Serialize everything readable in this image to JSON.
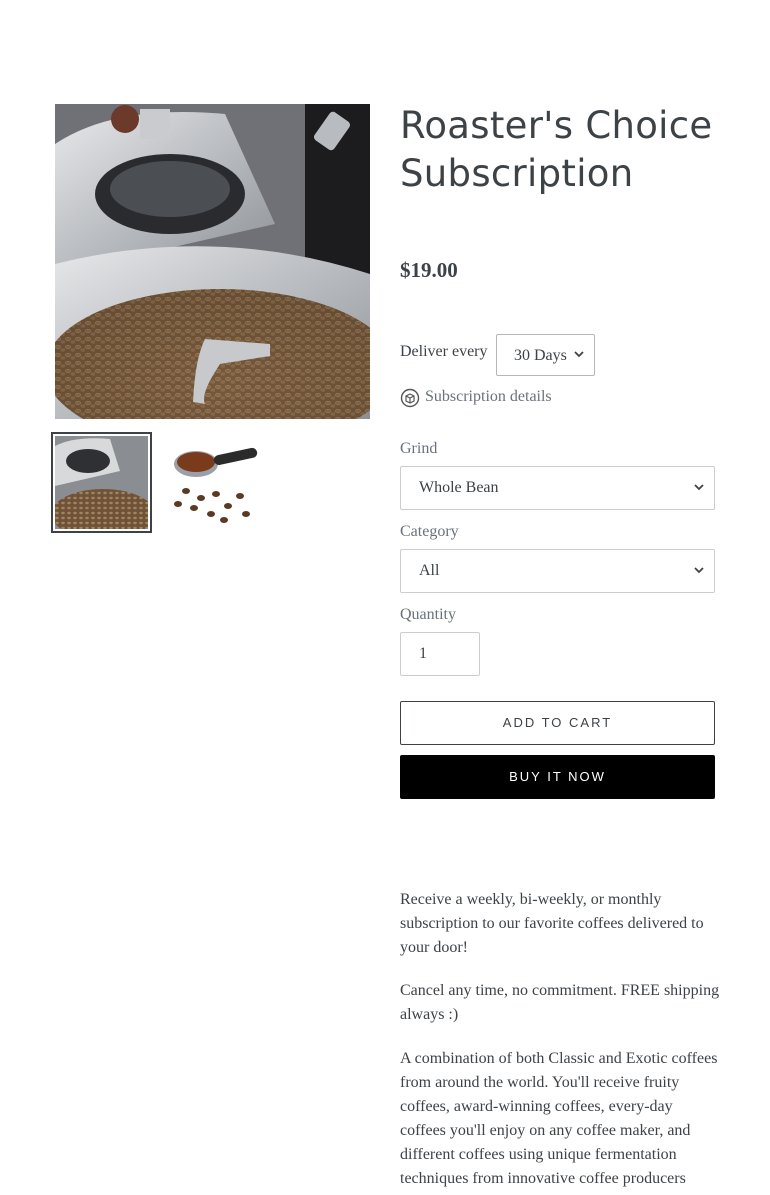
{
  "product": {
    "title": "Roaster's Choice Subscription",
    "price": "$19.00"
  },
  "subscription": {
    "deliver_label": "Deliver every",
    "deliver_value": "30 Days",
    "details_link": "Subscription details"
  },
  "options": {
    "grind_label": "Grind",
    "grind_value": "Whole Bean",
    "category_label": "Category",
    "category_value": "All",
    "quantity_label": "Quantity",
    "quantity_value": "1"
  },
  "buttons": {
    "add_to_cart": "ADD TO CART",
    "buy_now": "BUY IT NOW"
  },
  "description": {
    "p1": "Receive a weekly, bi-weekly, or monthly subscription to our favorite coffees delivered to your door!",
    "p2": "Cancel any time, no commitment. FREE shipping always :)",
    "p3": "A combination of both Classic and Exotic coffees from around the world. You'll receive fruity coffees, award-winning coffees, every-day coffees you'll enjoy on any coffee maker, and different coffees using unique fermentation techniques from innovative coffee producers"
  },
  "icons": {
    "chevron": "chevron-down-icon",
    "subscription": "subscription-box-icon"
  }
}
